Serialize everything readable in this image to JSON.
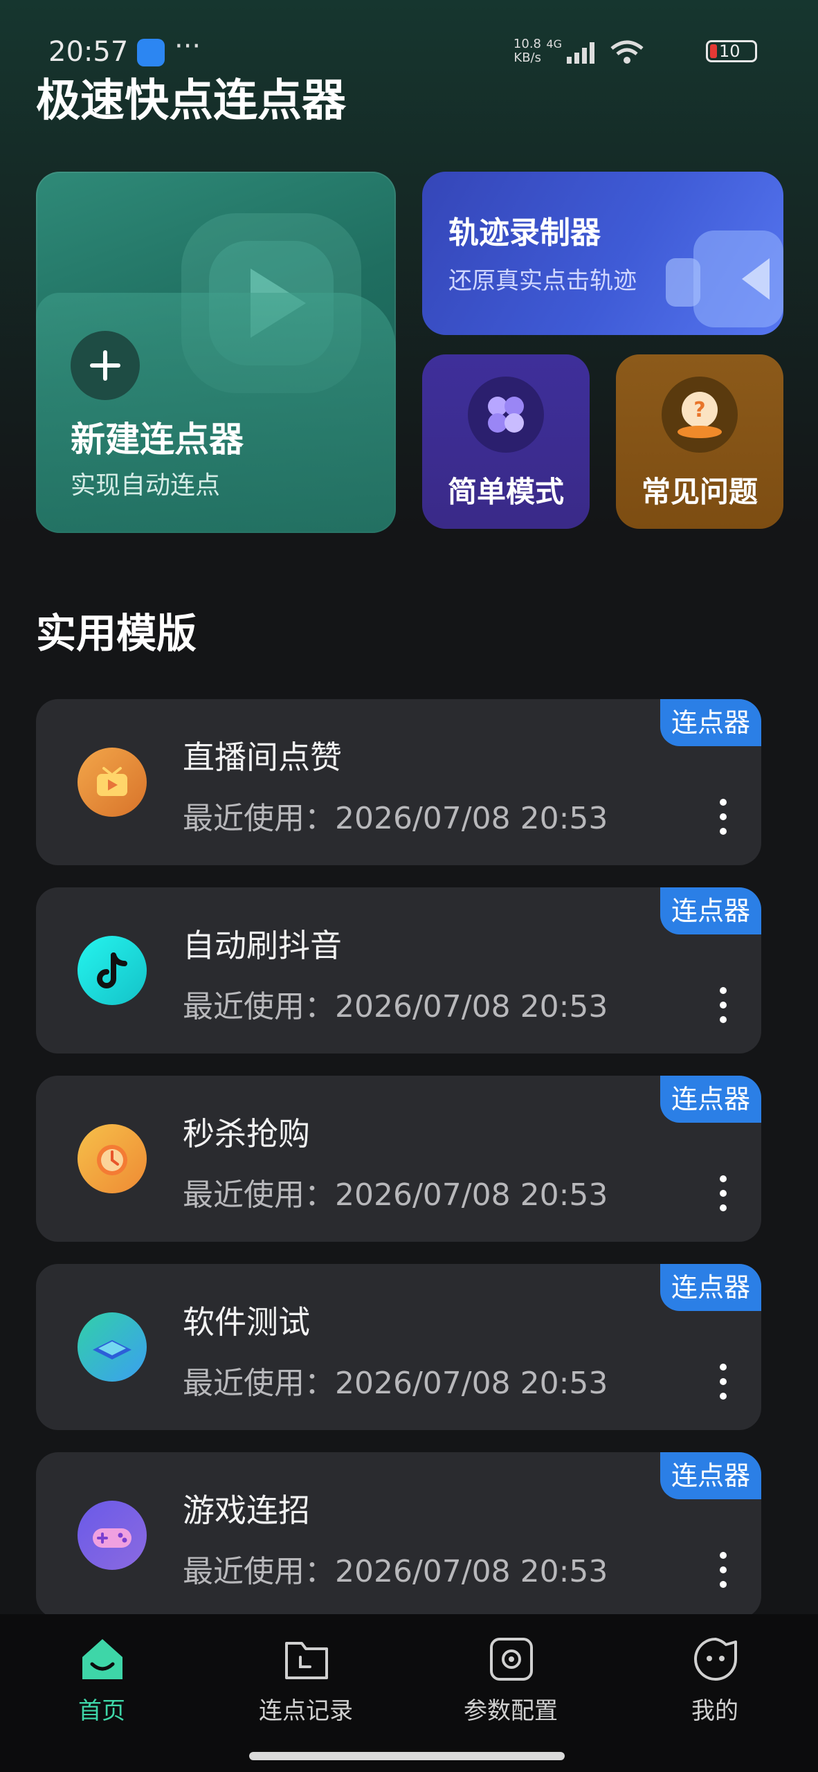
{
  "status_bar": {
    "time": "20:57",
    "more": "···",
    "speed": "10.8\nKB/s",
    "network": "4G",
    "battery": "10"
  },
  "app": {
    "title": "极速快点连点器"
  },
  "cards": {
    "new": {
      "title": "新建连点器",
      "subtitle": "实现自动连点",
      "icon": "plus-icon"
    },
    "track": {
      "title": "轨迹录制器",
      "subtitle": "还原真实点击轨迹",
      "icon": "camera-icon"
    },
    "simple": {
      "title": "简单模式",
      "icon": "clover-icon"
    },
    "faq": {
      "title": "常见问题",
      "icon": "question-icon"
    }
  },
  "section_title": "实用模版",
  "templates": [
    {
      "name": "直播间点赞",
      "time": "最近使用：2026/07/08 20:53",
      "badge": "连点器",
      "icon": "tv-icon",
      "color": "#e8943c"
    },
    {
      "name": "自动刷抖音",
      "time": "最近使用：2026/07/08 20:53",
      "badge": "连点器",
      "icon": "tiktok-icon",
      "color": "#1fd8d8"
    },
    {
      "name": "秒杀抢购",
      "time": "最近使用：2026/07/08 20:53",
      "badge": "连点器",
      "icon": "alarm-icon",
      "color": "#f0a53a"
    },
    {
      "name": "软件测试",
      "time": "最近使用：2026/07/08 20:53",
      "badge": "连点器",
      "icon": "chip-icon",
      "color": "#35bdd0"
    },
    {
      "name": "游戏连招",
      "time": "最近使用：2026/07/08 20:53",
      "badge": "连点器",
      "icon": "gamepad-icon",
      "color": "#7a63e0"
    }
  ],
  "nav": [
    {
      "label": "首页",
      "icon": "home-icon",
      "active": true
    },
    {
      "label": "连点记录",
      "icon": "folder-clock-icon",
      "active": false
    },
    {
      "label": "参数配置",
      "icon": "settings-icon",
      "active": false
    },
    {
      "label": "我的",
      "icon": "profile-face-icon",
      "active": false
    }
  ],
  "colors": {
    "accent": "#3ed6a8",
    "badge": "#2b7fe6",
    "card_bg": "#2a2b2f"
  }
}
